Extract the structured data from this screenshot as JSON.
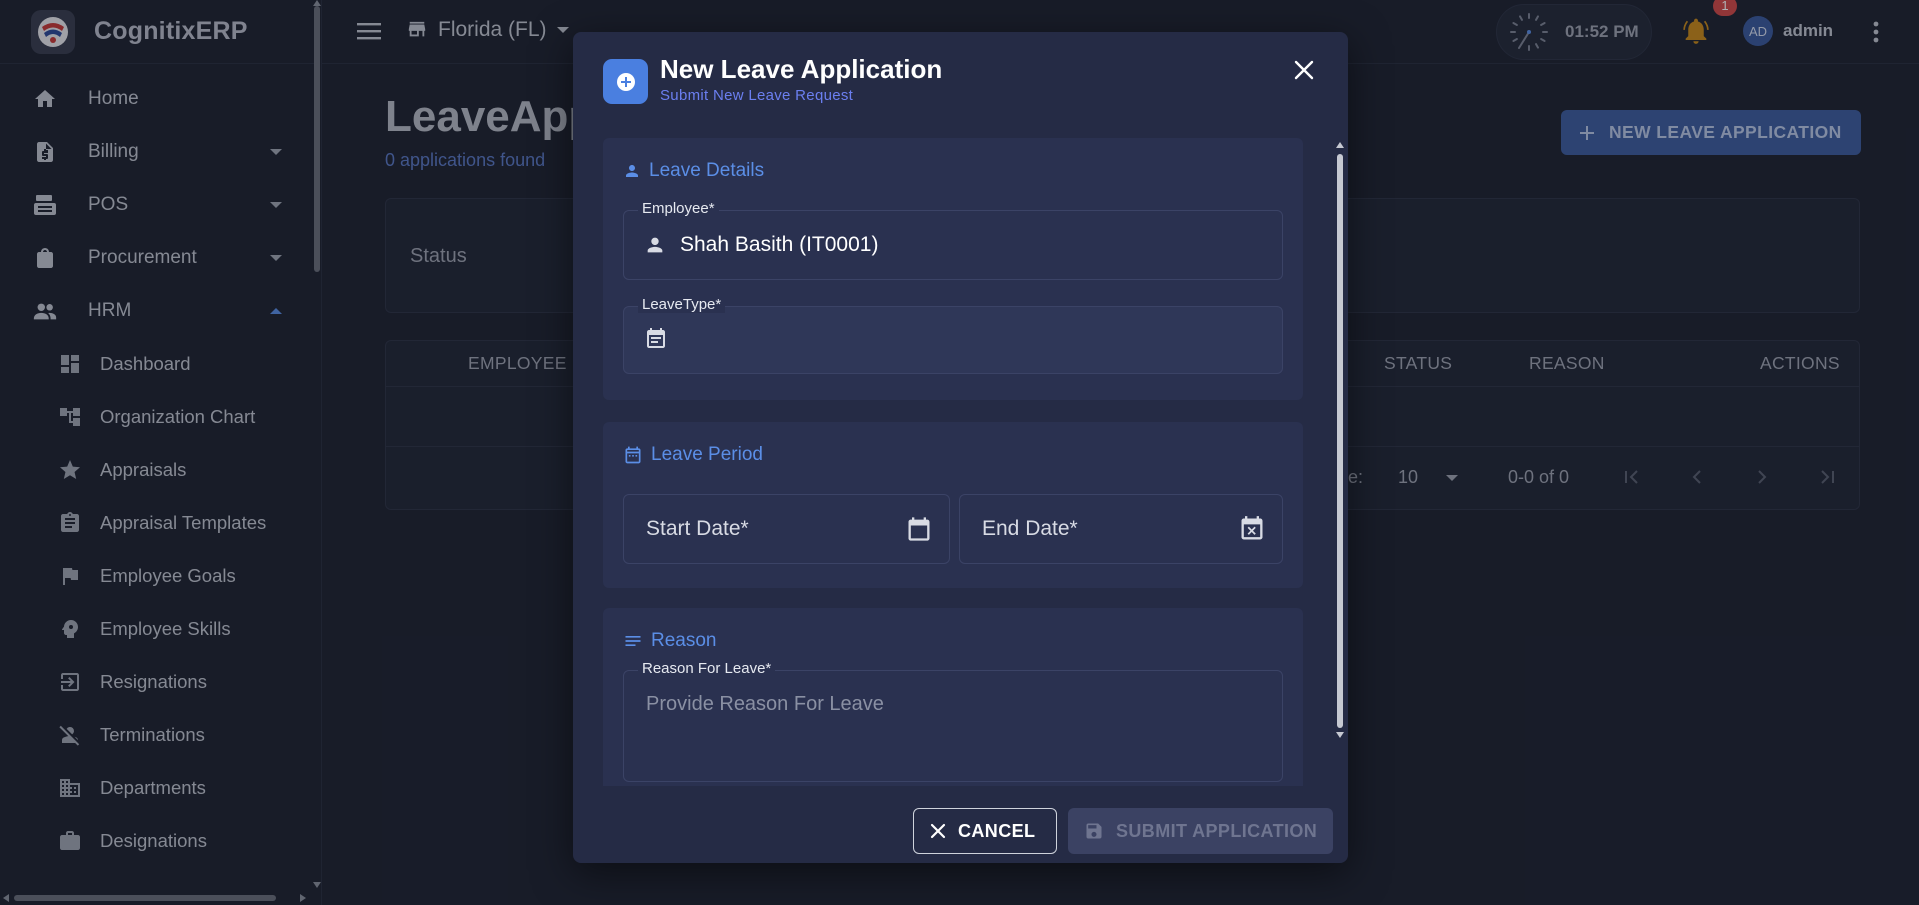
{
  "app": {
    "name": "CognitixERP"
  },
  "sidebar": {
    "items": [
      {
        "label": "Home",
        "icon": "home-icon"
      },
      {
        "label": "Billing",
        "icon": "billing-icon"
      },
      {
        "label": "POS",
        "icon": "pos-icon"
      },
      {
        "label": "Procurement",
        "icon": "shopping-bag-icon"
      },
      {
        "label": "HRM",
        "icon": "people-icon"
      }
    ],
    "hrm_items": [
      {
        "label": "Dashboard",
        "icon": "dashboard-icon"
      },
      {
        "label": "Organization Chart",
        "icon": "org-chart-icon"
      },
      {
        "label": "Appraisals",
        "icon": "star-icon"
      },
      {
        "label": "Appraisal Templates",
        "icon": "clipboard-icon"
      },
      {
        "label": "Employee Goals",
        "icon": "flag-icon"
      },
      {
        "label": "Employee Skills",
        "icon": "psychology-icon"
      },
      {
        "label": "Resignations",
        "icon": "exit-icon"
      },
      {
        "label": "Terminations",
        "icon": "person-off-icon"
      },
      {
        "label": "Departments",
        "icon": "building-icon"
      },
      {
        "label": "Designations",
        "icon": "briefcase-icon"
      }
    ]
  },
  "topbar": {
    "store": "Florida (FL)",
    "time": "01:52 PM",
    "notification_count": "1",
    "avatar_initials": "AD",
    "username": "admin"
  },
  "page": {
    "title": "LeaveApp",
    "subtitle": "0 applications found",
    "new_button": "NEW LEAVE APPLICATION",
    "status_filter": "Status",
    "table_headers": {
      "employee": "EMPLOYEE",
      "status": "STATUS",
      "reason": "REASON",
      "actions": "ACTIONS"
    },
    "rows_per_page_suffix": "e:",
    "rows_per_page": "10",
    "range": "0-0 of 0"
  },
  "modal": {
    "title": "New Leave Application",
    "subtitle": "Submit New Leave Request",
    "sections": {
      "details": "Leave Details",
      "period": "Leave Period",
      "reason": "Reason"
    },
    "employee_label": "Employee*",
    "employee_value": "Shah Basith (IT0001)",
    "leave_type_label": "LeaveType*",
    "start_date": "Start Date*",
    "end_date": "End Date*",
    "reason_label": "Reason For Leave*",
    "reason_placeholder": "Provide Reason For Leave",
    "cancel": "CANCEL",
    "submit": "SUBMIT APPLICATION"
  },
  "colors": {
    "accent": "#5b8ee6",
    "modal_bg": "#252b45",
    "section_bg": "#2a3150",
    "badge": "#d24a4a",
    "bell": "#c98a1c"
  }
}
